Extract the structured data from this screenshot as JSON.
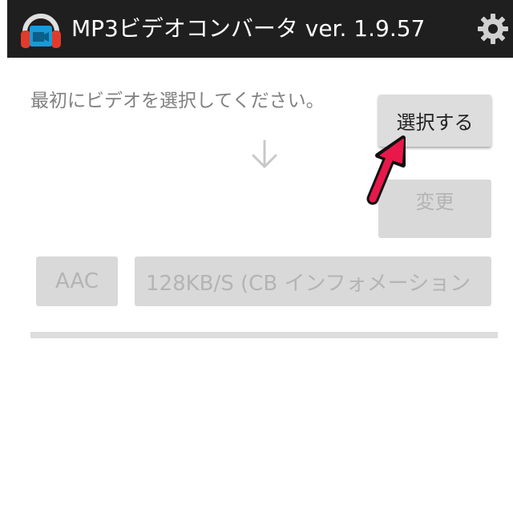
{
  "header": {
    "title": "MP3ビデオコンバータ ver. 1.9.57",
    "app_icon": "headphones-video-icon",
    "settings_icon": "gear-icon"
  },
  "main": {
    "prompt": "最初にビデオを選択してください。",
    "select_button": "選択する",
    "change_button": "変更",
    "format_button": "AAC",
    "bitrate_button": "128KB/S (CB インフォメーション",
    "flow_icon": "arrow-down-icon",
    "hint_icon": "red-arrow-pointer-icon"
  },
  "progress": {
    "value": 0
  },
  "colors": {
    "topbar": "#1f1f1f",
    "button_bg": "#d9d9d9",
    "disabled_text": "#b4b4b4",
    "accent_red": "#e8184b"
  }
}
